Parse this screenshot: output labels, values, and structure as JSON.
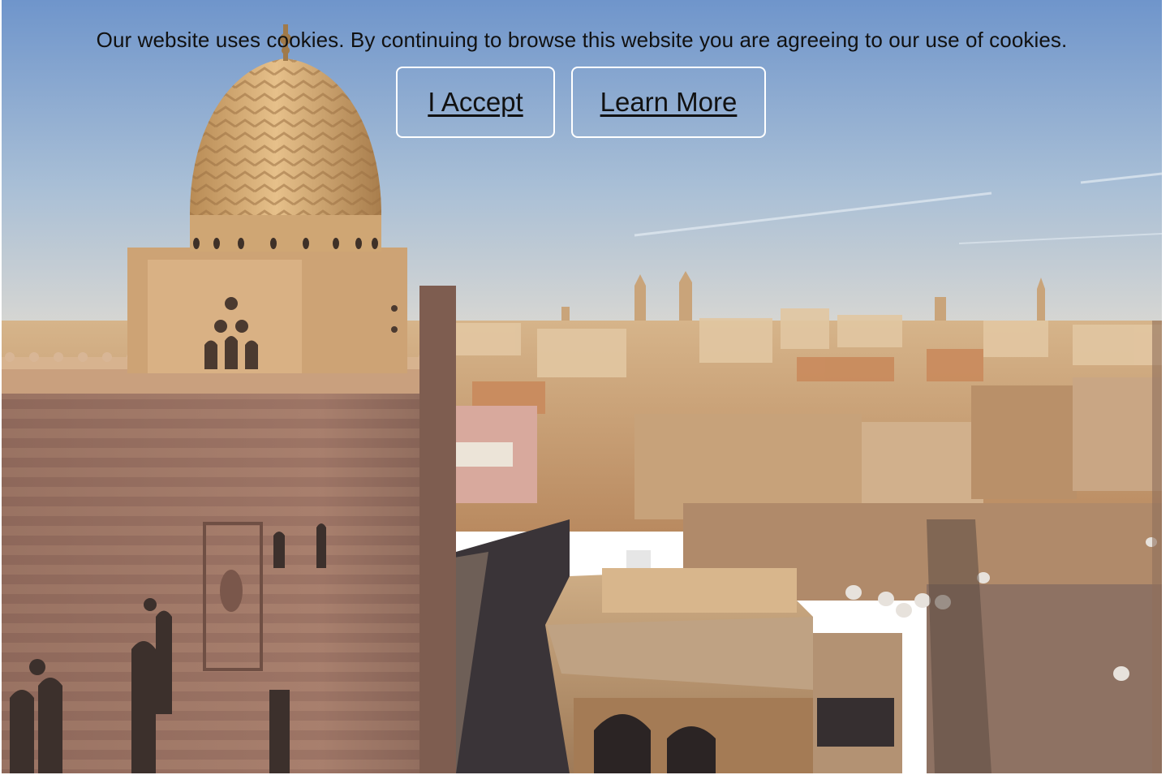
{
  "cookie_banner": {
    "message": "Our website uses cookies. By continuing to browse this website you are agreeing to our use of cookies.",
    "accept_label": "I Accept",
    "learn_more_label": "Learn More"
  },
  "background_image": {
    "colors": {
      "sky_top": "#7d9fcf",
      "sky_horizon": "#d8d9d6",
      "sandstone": "#c9a06e",
      "mosque_wall": "#a67d6a",
      "street_shadow": "#3a3438"
    }
  }
}
